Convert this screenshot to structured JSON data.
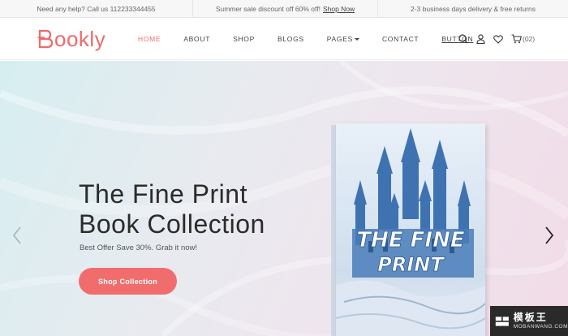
{
  "topbar": {
    "help": "Need any help? Call us 112233344455",
    "sale": "Summer sale discount off 60% off!",
    "sale_link": "Shop Now",
    "delivery": "2-3 business days delivery & free returns"
  },
  "brand": {
    "name": "ookly",
    "accent": "#ef6a6a"
  },
  "nav": {
    "items": [
      {
        "label": "HOME",
        "active": true
      },
      {
        "label": "ABOUT"
      },
      {
        "label": "SHOP"
      },
      {
        "label": "BLOGS"
      },
      {
        "label": "PAGES"
      },
      {
        "label": "CONTACT"
      },
      {
        "label": "BUTTON"
      }
    ]
  },
  "header_icons": {
    "search": "search-icon",
    "account": "user-icon",
    "wishlist": "heart-icon",
    "cart": "cart-icon",
    "cart_count": "(02)"
  },
  "hero": {
    "title_line1": "The Fine Print",
    "title_line2": "Book Collection",
    "subtitle": "Best Offer Save 30%. Grab it now!",
    "cta": "Shop Collection",
    "prev": "chevron-left-icon",
    "next": "chevron-right-icon",
    "book_title": "THE FINE PRINT"
  },
  "watermark": {
    "cn": "模板王",
    "en": "MOBANWANG.COM"
  }
}
